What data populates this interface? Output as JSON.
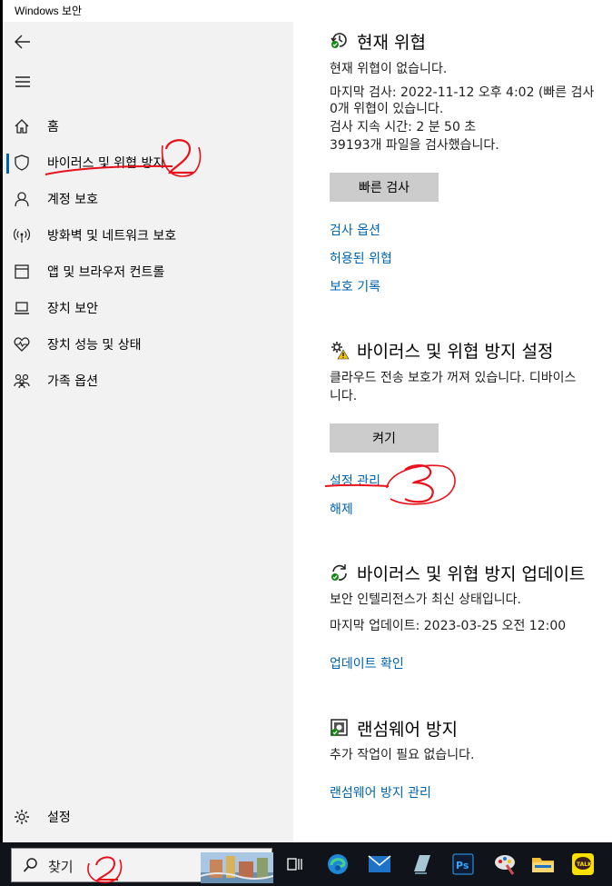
{
  "window": {
    "title": "Windows 보안"
  },
  "sidebar": {
    "back_icon": "back-arrow-icon",
    "menu_icon": "hamburger-menu-icon",
    "items": [
      {
        "label": "홈",
        "icon": "home-icon"
      },
      {
        "label": "바이러스 및 위협 방지",
        "icon": "shield-icon",
        "active": true
      },
      {
        "label": "계정 보호",
        "icon": "person-icon"
      },
      {
        "label": "방화벽 및 네트워크 보호",
        "icon": "wireless-icon"
      },
      {
        "label": "앱 및 브라우저 컨트롤",
        "icon": "app-window-icon"
      },
      {
        "label": "장치 보안",
        "icon": "laptop-icon"
      },
      {
        "label": "장치 성능 및 상태",
        "icon": "heart-icon"
      },
      {
        "label": "가족 옵션",
        "icon": "family-icon"
      }
    ],
    "settings_label": "설정"
  },
  "current_threats": {
    "title": "현재 위협",
    "status": "현재 위협이 없습니다.",
    "last_scan_line1": "마지막 검사: 2022-11-12 오후 4:02 (빠른 검사",
    "last_scan_line2": "0개 위협이 있습니다.",
    "duration": "검사 지속 시간: 2 분 50 초",
    "files_scanned": "39193개 파일을 검사했습니다.",
    "quick_scan_button": "빠른 검사",
    "links": [
      "검사 옵션",
      "허용된 위협",
      "보호 기록"
    ]
  },
  "protection_settings": {
    "title": "바이러스 및 위협 방지 설정",
    "message_line1": "클라우드 전송 보호가 꺼져 있습니다. 디바이스",
    "message_line2": "니다.",
    "turn_on_button": "켜기",
    "manage_link": "설정 관리",
    "dismiss_link": "해제"
  },
  "updates": {
    "title": "바이러스 및 위협 방지 업데이트",
    "status": "보안 인텔리전스가 최신 상태입니다.",
    "last_update": "마지막 업데이트: 2023-03-25 오전 12:00",
    "check_link": "업데이트 확인"
  },
  "ransomware": {
    "title": "랜섬웨어 방지",
    "status": "추가 작업이 필요 없습니다.",
    "manage_link": "랜섬웨어 방지 관리"
  },
  "taskbar": {
    "search_placeholder": "찾기",
    "apps": [
      "task-view-icon",
      "edge-icon",
      "mail-icon",
      "notes-icon",
      "photoshop-icon",
      "paint-icon",
      "file-explorer-icon",
      "kakaotalk-icon"
    ],
    "photoshop_label": "Ps",
    "kakaotalk_label": "TALK"
  },
  "colors": {
    "accent": "#0063b1",
    "annotation": "#e8101a",
    "sidebar_bg": "#f2f2f2",
    "button_bg": "#cccccc"
  }
}
